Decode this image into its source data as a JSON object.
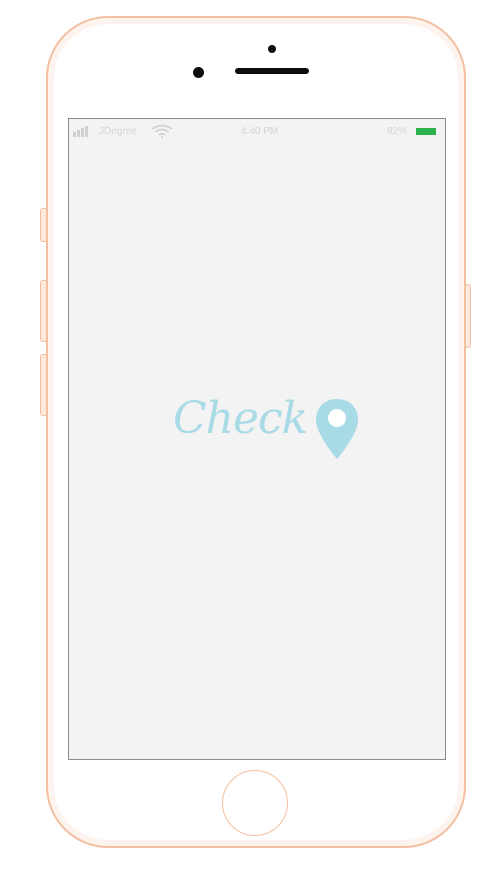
{
  "device": {
    "frame_color": "#f3bfa0",
    "screen_background": "#f3f3f3"
  },
  "status_bar": {
    "carrier": "JDegree",
    "time": "4:40 PM",
    "battery_percent": "82%",
    "battery_color": "#2bb24c",
    "signal_icon": "signal-bars-icon",
    "wifi_icon": "wifi-icon",
    "battery_icon": "battery-icon"
  },
  "splash": {
    "logo_text": "Check",
    "logo_color": "#a9dbe6",
    "logo_icon": "location-pin-icon"
  }
}
